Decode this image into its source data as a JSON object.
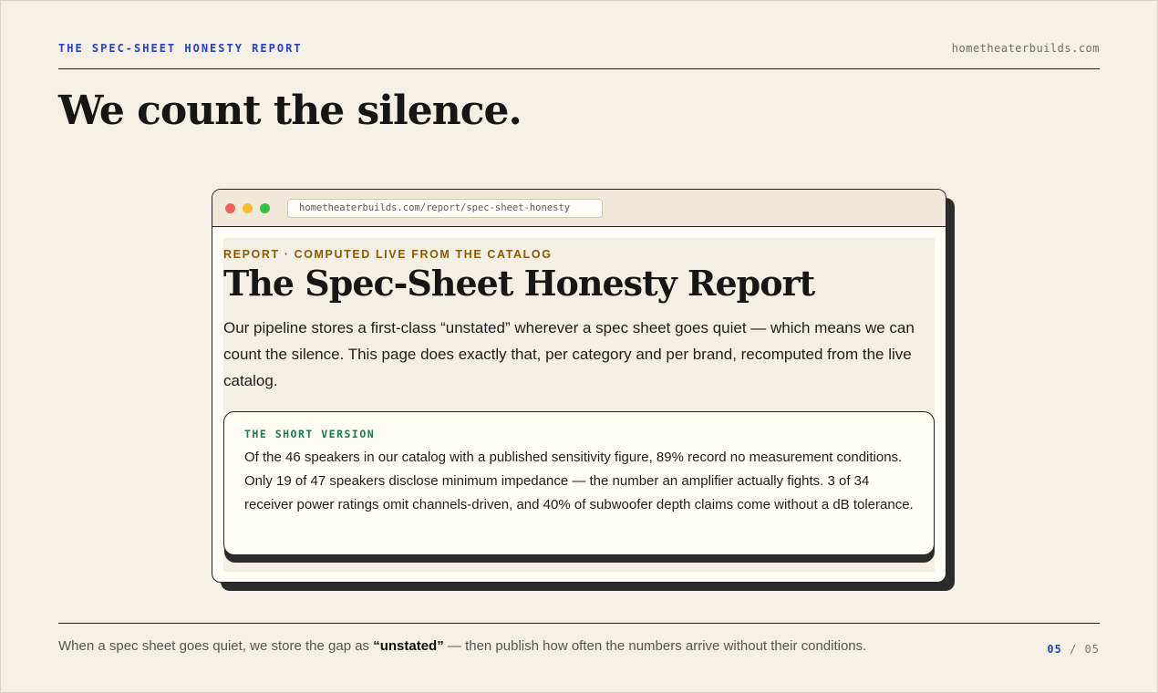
{
  "header": {
    "kicker": "THE SPEC-SHEET HONESTY REPORT",
    "domain": "hometheaterbuilds.com"
  },
  "slide_title": "We count the silence.",
  "browser": {
    "url": "hometheaterbuilds.com/report/spec-sheet-honesty",
    "page": {
      "eyebrow": "REPORT · COMPUTED LIVE FROM THE CATALOG",
      "title": "The Spec-Sheet Honesty Report",
      "lede": "Our pipeline stores a first-class “unstated” wherever a spec sheet goes quiet — which means we can count the silence. This page does exactly that, per category and per brand, recomputed from the live catalog.",
      "summary": {
        "label": "THE SHORT VERSION",
        "body": "Of the 46 speakers in our catalog with a published sensitivity figure, 89% record no measurement conditions. Only 19 of 47 speakers disclose minimum impedance — the number an amplifier actually fights. 3 of 34 receiver power ratings omit channels-driven, and 40% of subwoofer depth claims come without a dB tolerance."
      }
    }
  },
  "footer": {
    "text_before": "When a spec sheet goes quiet, we store the gap as ",
    "text_bold": "“unstated”",
    "text_after": " — then publish how often the numbers arrive without their conditions.",
    "page_current": "05",
    "page_separator": "/",
    "page_total": "05"
  },
  "colors": {
    "background": "#f4f0e6",
    "accent_blue": "#2a3fc7",
    "eyebrow_brown": "#8a5a07",
    "summary_green": "#1b7a4f"
  }
}
